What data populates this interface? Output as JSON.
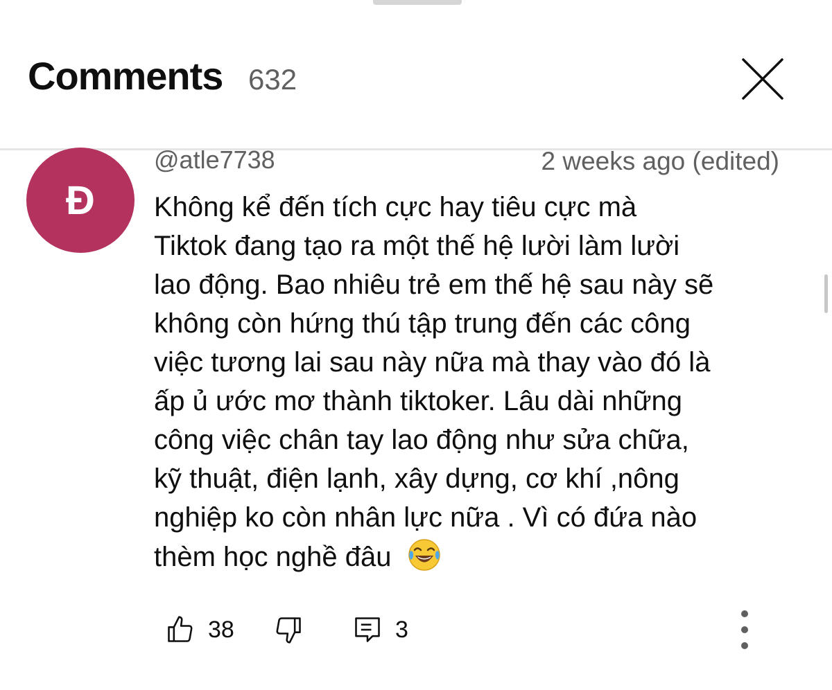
{
  "header": {
    "title": "Comments",
    "count": "632"
  },
  "comment": {
    "avatar_letter": "Đ",
    "avatar_color": "#b3325e",
    "author": "@atle7738",
    "timestamp": "2 weeks ago (edited)",
    "lines": [
      "Không kể đến tích cực hay tiêu cực mà",
      "Tiktok đang tạo ra một thế hệ lười làm lười",
      "lao động. Bao nhiêu trẻ em thế hệ sau này sẽ",
      "không còn hứng thú tập trung đến các công",
      "việc tương lai sau này nữa mà thay vào đó là",
      "ấp ủ ước mơ thành tiktoker. Lâu dài những",
      "công việc chân tay lao động như sửa chữa,",
      "kỹ thuật, điện lạnh, xây dựng, cơ khí ,nông",
      "nghiệp ko còn nhân lực nữa . Vì có đứa nào",
      "thèm học nghề đâu"
    ],
    "emoji": "face-with-tears-of-joy",
    "likes": "38",
    "replies": "3"
  },
  "icons": {
    "close": "close-icon",
    "like": "thumbs-up-icon",
    "dislike": "thumbs-down-icon",
    "reply": "reply-comment-icon",
    "menu": "more-vertical-icon"
  },
  "colors": {
    "text": "#0f0f0f",
    "secondary": "#606060",
    "divider": "#e5e5e5"
  }
}
